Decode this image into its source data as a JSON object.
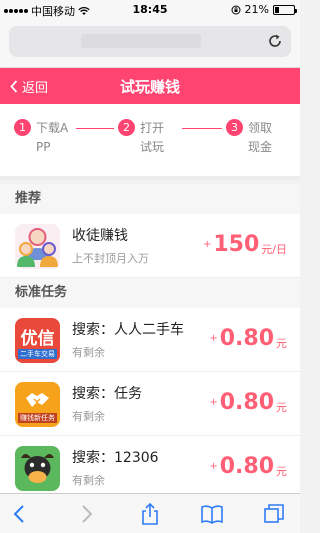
{
  "status_bar": {
    "carrier": "中国移动",
    "time": "18:45",
    "battery_percent": "21%",
    "battery_level": 0.21
  },
  "browser": {
    "url": ""
  },
  "header": {
    "back_label": "返回",
    "title": "试玩赚钱",
    "accent_color": "#ff4472"
  },
  "steps": [
    {
      "number": "1",
      "label": "下载APP"
    },
    {
      "number": "2",
      "label": "打开试玩"
    },
    {
      "number": "3",
      "label": "领取现金"
    }
  ],
  "recommend": {
    "section_title": "推荐",
    "item": {
      "name": "收徒赚钱",
      "subtitle": "上不封顶月入万",
      "plus": "+",
      "amount": "150",
      "unit": "元/日",
      "icon": "people-icon"
    }
  },
  "standard": {
    "section_title": "标准任务",
    "items": [
      {
        "name": "搜索：人人二手车",
        "subtitle": "有剩余",
        "plus": "+",
        "amount": "0.80",
        "unit": "元",
        "icon_text": "优信",
        "icon_caption": "二手车交易",
        "icon": "youxin-app-icon"
      },
      {
        "name": "搜索：任务",
        "subtitle": "有剩余",
        "plus": "+",
        "amount": "0.80",
        "unit": "元",
        "icon_text": "手",
        "icon_caption": "赚钱新任务",
        "icon": "handshake-app-icon"
      },
      {
        "name": "搜索：12306",
        "subtitle": "有剩余",
        "plus": "+",
        "amount": "0.80",
        "unit": "元",
        "icon_text": "",
        "icon_caption": "",
        "icon": "cow-app-icon"
      }
    ]
  }
}
